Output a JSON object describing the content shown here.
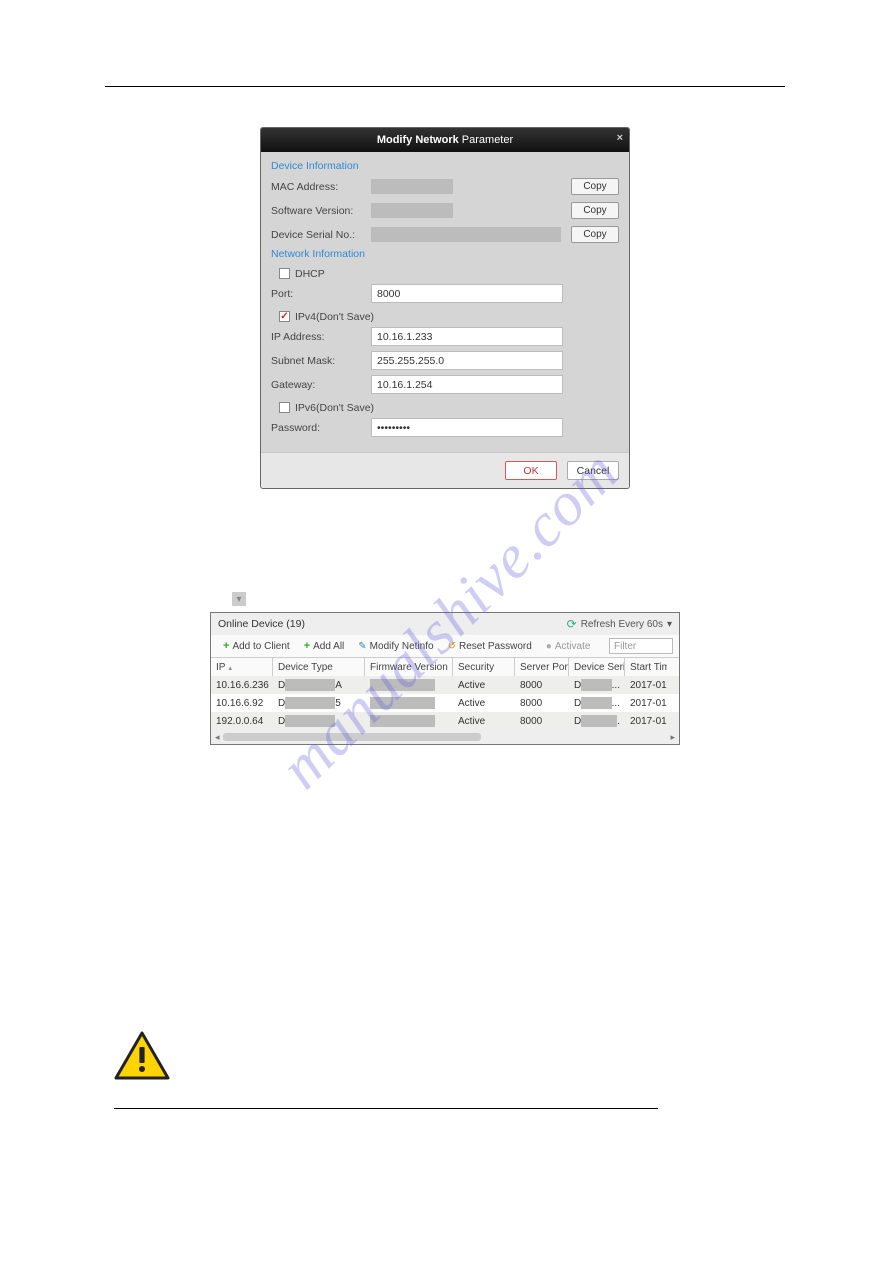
{
  "modal": {
    "title_bold": "Modify Network",
    "title_normal": " Parameter",
    "sections": {
      "device_info": "Device Information",
      "network_info": "Network Information"
    },
    "labels": {
      "mac": "MAC Address:",
      "sw": "Software Version:",
      "serial": "Device Serial No.:",
      "dhcp": "DHCP",
      "port": "Port:",
      "ipv4": "IPv4(Don't Save)",
      "ip": "IP Address:",
      "subnet": "Subnet Mask:",
      "gateway": "Gateway:",
      "ipv6": "IPv6(Don't Save)",
      "password": "Password:"
    },
    "values": {
      "port": "8000",
      "ip": "10.16.1.233",
      "subnet": "255.255.255.0",
      "gateway": "10.16.1.254",
      "password": "•••••••••"
    },
    "buttons": {
      "copy": "Copy",
      "ok": "OK",
      "cancel": "Cancel"
    }
  },
  "grid": {
    "title": "Online Device (19)",
    "refresh": "Refresh Every 60s",
    "toolbar": {
      "add_client": "Add to Client",
      "add_all": "Add All",
      "modify_net": "Modify Netinfo",
      "reset_pw": "Reset Password",
      "activate": "Activate",
      "filter_placeholder": "Filter"
    },
    "columns": {
      "ip": "IP",
      "device_type": "Device Type",
      "firmware": "Firmware Version",
      "security": "Security",
      "server_port": "Server Port",
      "serial": "Device Serial No.",
      "start": "Start Tim"
    },
    "rows": [
      {
        "ip": "10.16.6.236",
        "dt_prefix": "D",
        "dt_suffix": "A",
        "security": "Active",
        "port": "8000",
        "sn_prefix": "D",
        "sn_suffix": "...",
        "start": "2017-01"
      },
      {
        "ip": "10.16.6.92",
        "dt_prefix": "D",
        "dt_suffix": "5",
        "security": "Active",
        "port": "8000",
        "sn_prefix": "D",
        "sn_suffix": "...",
        "start": "2017-01"
      },
      {
        "ip": "192.0.0.64",
        "dt_prefix": "D",
        "dt_suffix": "",
        "security": "Active",
        "port": "8000",
        "sn_prefix": "D",
        "sn_suffix": ". ",
        "start": "2017-01"
      }
    ]
  },
  "watermark": "manualshive.com"
}
